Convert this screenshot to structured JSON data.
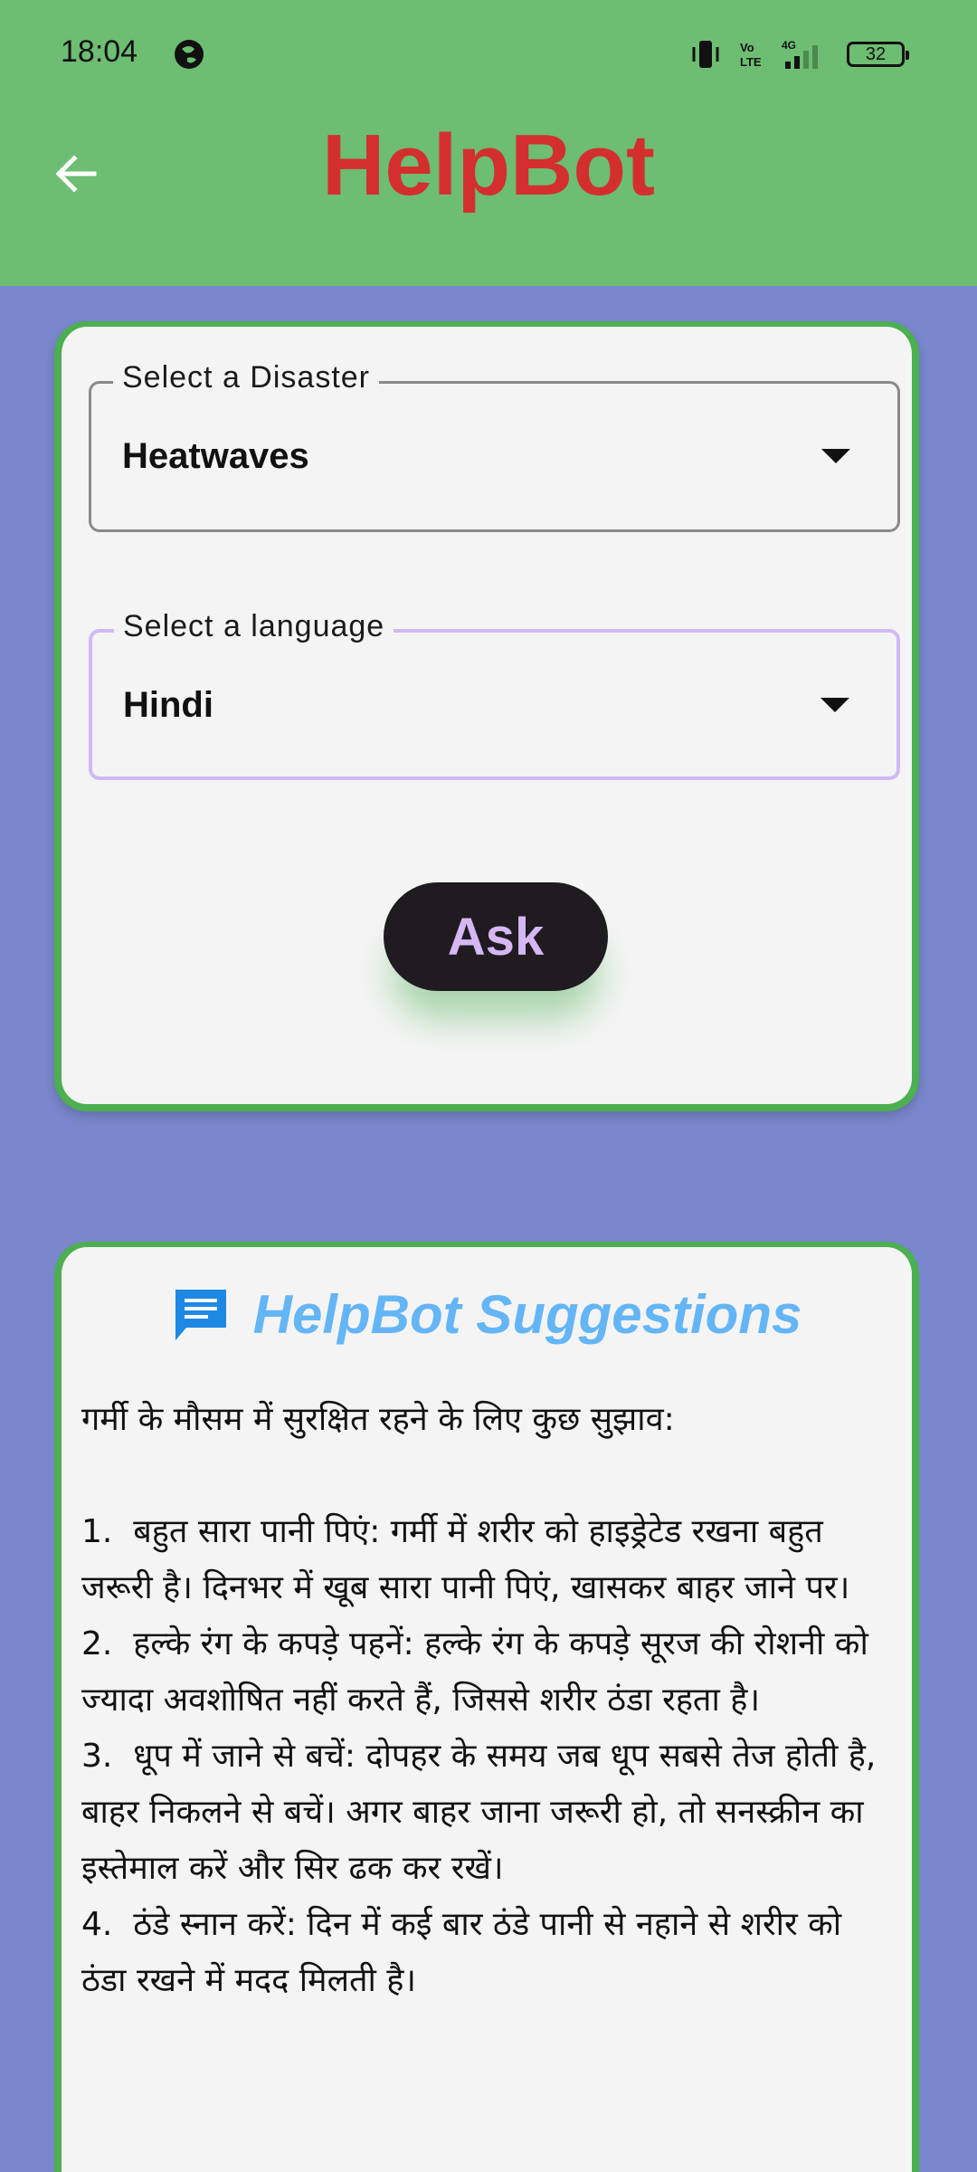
{
  "status_bar": {
    "time": "18:04",
    "battery": "32",
    "network": "4G",
    "volte": "Vo LTE"
  },
  "app_bar": {
    "title": "HelpBot",
    "back_icon": "arrow-back-icon"
  },
  "form": {
    "disaster": {
      "label": "Select a Disaster",
      "value": "Heatwaves"
    },
    "language": {
      "label": "Select a language",
      "value": "Hindi"
    },
    "ask_label": "Ask"
  },
  "suggestions": {
    "title": "HelpBot Suggestions",
    "icon": "chat-icon",
    "text": "गर्मी के मौसम में सुरक्षित रहने के लिए कुछ सुझाव:\n\n1.  बहुत सारा पानी पिएं: गर्मी में शरीर को हाइड्रेटेड रखना बहुत जरूरी है। दिनभर में खूब सारा पानी पिएं, खासकर बाहर जाने पर।\n2.  हल्के रंग के कपड़े पहनें: हल्के रंग के कपड़े सूरज की रोशनी को ज्यादा अवशोषित नहीं करते हैं, जिससे शरीर ठंडा रहता है।\n3.  धूप में जाने से बचें: दोपहर के समय जब धूप सबसे तेज होती है, बाहर निकलने से बचें। अगर बाहर जाना जरूरी हो, तो सनस्क्रीन का इस्तेमाल करें और सिर ढक कर रखें।\n4.  ठंडे स्नान करें: दिन में कई बार ठंडे पानी से नहाने से शरीर को ठंडा रखने में मदद मिलती है।"
  },
  "colors": {
    "app_bar": "#6dbd72",
    "background": "#7986cb",
    "title": "#d32f2f",
    "card_border": "#4caf50",
    "suggestion_title": "#64b5f6",
    "ask_button": "#1f1b20",
    "ask_text": "#d4b7f3"
  }
}
